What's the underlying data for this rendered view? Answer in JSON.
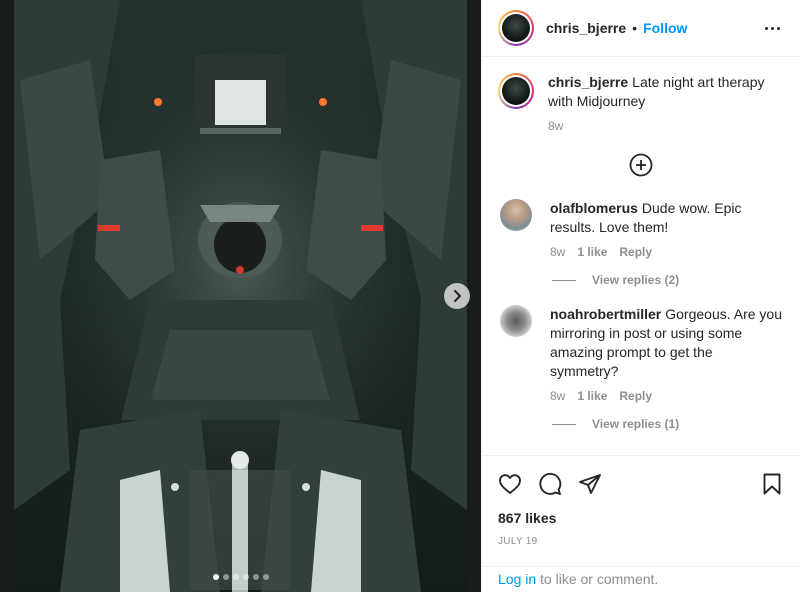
{
  "header": {
    "username": "chris_bjerre",
    "separator": "•",
    "follow_label": "Follow"
  },
  "caption": {
    "username": "chris_bjerre",
    "text": "Late night art therapy with Midjourney",
    "age": "8w"
  },
  "comments": [
    {
      "username": "olafblomerus",
      "text": "Dude wow. Epic results. Love them!",
      "age": "8w",
      "likes": "1 like",
      "reply_label": "Reply",
      "view_replies": "View replies (2)"
    },
    {
      "username": "noahrobertmiller",
      "text": "Gorgeous. Are you mirroring in post or using some amazing prompt to get the symmetry?",
      "age": "8w",
      "likes": "1 like",
      "reply_label": "Reply",
      "view_replies": "View replies (1)"
    }
  ],
  "likes_count": "867 likes",
  "date": "JULY 19",
  "login": {
    "link": "Log in",
    "text": "to like or comment."
  },
  "carousel": {
    "slide_count": 6,
    "active_index": 0
  },
  "colors": {
    "accent": "#0095f6",
    "text_primary": "#262626",
    "text_secondary": "#8e8e8e"
  },
  "icons": [
    "chevron-right-icon",
    "more-options-icon",
    "add-comment-icon",
    "heart-icon",
    "comment-icon",
    "share-icon",
    "bookmark-icon"
  ]
}
